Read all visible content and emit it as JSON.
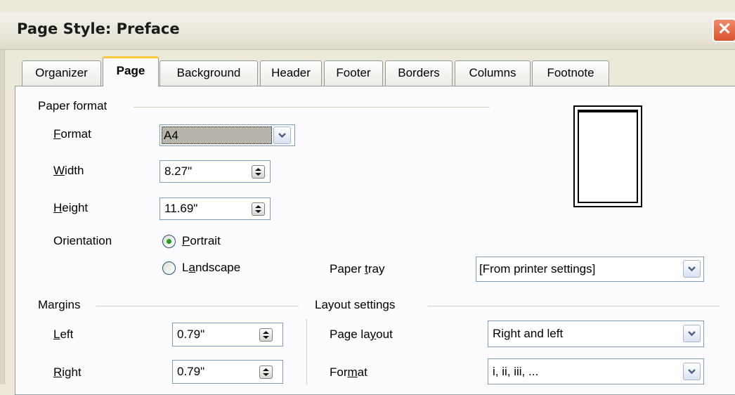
{
  "window": {
    "title": "Page Style: Preface",
    "close_icon": "close-icon"
  },
  "tabs": [
    {
      "label": "Organizer"
    },
    {
      "label": "Page",
      "active": true
    },
    {
      "label": "Background"
    },
    {
      "label": "Header"
    },
    {
      "label": "Footer"
    },
    {
      "label": "Borders"
    },
    {
      "label": "Columns"
    },
    {
      "label": "Footnote"
    }
  ],
  "paper_format": {
    "title": "Paper format",
    "format": {
      "label": "Format",
      "value": "A4"
    },
    "width": {
      "label": "Width",
      "value": "8.27\""
    },
    "height": {
      "label": "Height",
      "value": "11.69\""
    },
    "orientation": {
      "label": "Orientation",
      "portrait": "Portrait",
      "landscape": "Landscape",
      "selected": "Portrait"
    },
    "paper_tray": {
      "label": "Paper tray",
      "value": "[From printer settings]"
    }
  },
  "margins": {
    "title": "Margins",
    "left": {
      "label": "Left",
      "value": "0.79\""
    },
    "right": {
      "label": "Right",
      "value": "0.79\""
    }
  },
  "layout_settings": {
    "title": "Layout settings",
    "page_layout": {
      "label": "Page layout",
      "value": "Right and left"
    },
    "format": {
      "label": "Format",
      "value": "i, ii, iii, ..."
    }
  },
  "colors": {
    "accent_tab": "#ffc73c",
    "close_button": "#d9542e",
    "field_border": "#7f9db9"
  }
}
